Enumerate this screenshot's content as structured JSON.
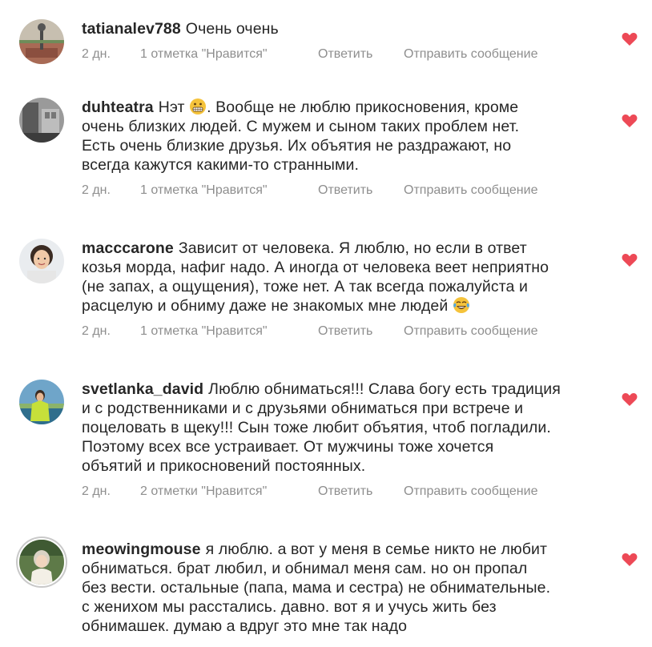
{
  "comments": [
    {
      "username": "tatianalev788",
      "text": "Очень очень",
      "time": "2 дн.",
      "likes": "1 отметка \"Нравится\"",
      "reply": "Ответить",
      "message": "Отправить сообщение"
    },
    {
      "username": "duhteatra",
      "text_before_emoji": "Нэт",
      "emoji": "grimacing-face-emoji",
      "text": ". Вообще не люблю прикосновения, кроме\nочень близких людей. С мужем и сыном таких проблем нет.\nЕсть очень близкие друзья. Их объятия не раздражают, но\nвсегда кажутся какими-то странными.",
      "time": "2 дн.",
      "likes": "1 отметка \"Нравится\"",
      "reply": "Ответить",
      "message": "Отправить сообщение"
    },
    {
      "username": "macccarone",
      "text": "Зависит от человека. Я люблю, но если в ответ\nкозья морда, нафиг надо. А иногда от человека веет неприятно\n(не запах, а ощущения), тоже нет. А так всегда пожалуйста и\nрасцелую и обниму даже не знакомых мне людей",
      "emoji": "tears-of-joy-emoji",
      "time": "2 дн.",
      "likes": "1 отметка \"Нравится\"",
      "reply": "Ответить",
      "message": "Отправить сообщение"
    },
    {
      "username": "svetlanka_david",
      "text": "Люблю обниматься!!! Слава богу есть традиция\nи с родственниками и с друзьями обниматься при встрече и\nпоцеловать в щеку!!! Сын тоже любит объятия, чтоб погладили.\nПоэтому всех все устраивает. От мужчины тоже хочется\nобъятий и прикосновений постоянных.",
      "time": "2 дн.",
      "likes": "2 отметки \"Нравится\"",
      "reply": "Ответить",
      "message": "Отправить сообщение"
    },
    {
      "username": "meowingmouse",
      "text": "я люблю. а вот у меня в семье никто не любит\nобниматься. брат любил, и обнимал меня сам. но он пропал\nбез вести. остальные (папа, мама и сестра) не обнимательные.\nс женихом мы расстались. давно. вот я и учусь жить без\nобнимашек. думаю а вдруг это мне так надо"
    }
  ],
  "colors": {
    "text": "#262626",
    "meta": "#8e8e8e",
    "heart": "#ed4956"
  },
  "icons": {
    "like": "heart-icon"
  }
}
